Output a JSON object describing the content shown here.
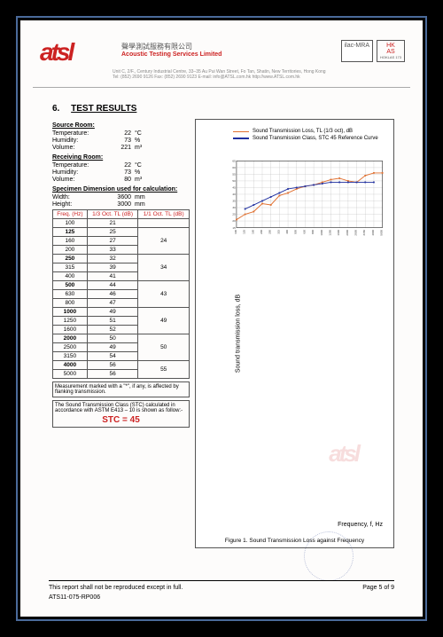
{
  "letterhead": {
    "logo_text": "atsl",
    "company_ch": "聲學測試服務有限公司",
    "company_en": "Acoustic Testing Services Limited",
    "address": "Unit C, 2/F., Century Industrial Centre, 33–35 Au Pui Wan Street, Fo Tan, Shatin, New Territories, Hong Kong   Tel: (852) 2690 9126   Fax: (852) 2690 9123   E-mail: info@ATSL.com.hk   http://www.ATSL.com.hk",
    "accred_left": "ilac-MRA",
    "accred_right_top": "HK",
    "accred_right_bottom": "AS",
    "accred_num": "HOKLAS 173"
  },
  "section": {
    "number": "6.",
    "title": "TEST RESULTS"
  },
  "source_room": {
    "heading": "Source Room:",
    "items": [
      {
        "label": "Temperature:",
        "value": "22",
        "unit": "°C"
      },
      {
        "label": "Humidity:",
        "value": "73",
        "unit": "%"
      },
      {
        "label": "Volume:",
        "value": "221",
        "unit": "m³"
      }
    ]
  },
  "receiving_room": {
    "heading": "Receiving Room:",
    "items": [
      {
        "label": "Temperature:",
        "value": "22",
        "unit": "°C"
      },
      {
        "label": "Humidity:",
        "value": "73",
        "unit": "%"
      },
      {
        "label": "Volume:",
        "value": "80",
        "unit": "m³"
      }
    ]
  },
  "specimen": {
    "heading": "Specimen Dimension used for calculation:",
    "items": [
      {
        "label": "Width:",
        "value": "3600",
        "unit": "mm"
      },
      {
        "label": "Height:",
        "value": "3000",
        "unit": "mm"
      }
    ]
  },
  "freq_table": {
    "headers": [
      "Freq. (Hz)",
      "1/3 Oct. TL (dB)",
      "1/1 Oct. TL (dB)"
    ],
    "rows": [
      {
        "f": "100",
        "t3": "21",
        "t1": "",
        "b": false
      },
      {
        "f": "125",
        "t3": "25",
        "t1": "24",
        "b": true
      },
      {
        "f": "160",
        "t3": "27",
        "t1": "",
        "b": false
      },
      {
        "f": "200",
        "t3": "33",
        "t1": "",
        "b": false
      },
      {
        "f": "250",
        "t3": "32",
        "t1": "34",
        "b": true
      },
      {
        "f": "315",
        "t3": "39",
        "t1": "",
        "b": false
      },
      {
        "f": "400",
        "t3": "41",
        "t1": "",
        "b": false
      },
      {
        "f": "500",
        "t3": "44",
        "t1": "43",
        "b": true
      },
      {
        "f": "630",
        "t3": "46",
        "t1": "",
        "b": false
      },
      {
        "f": "800",
        "t3": "47",
        "t1": "",
        "b": false
      },
      {
        "f": "1000",
        "t3": "49",
        "t1": "49",
        "b": true
      },
      {
        "f": "1250",
        "t3": "51",
        "t1": "",
        "b": false
      },
      {
        "f": "1600",
        "t3": "52",
        "t1": "",
        "b": false
      },
      {
        "f": "2000",
        "t3": "50",
        "t1": "50",
        "b": true
      },
      {
        "f": "2500",
        "t3": "49",
        "t1": "",
        "b": false
      },
      {
        "f": "3150",
        "t3": "54",
        "t1": "",
        "b": false
      },
      {
        "f": "4000",
        "t3": "56",
        "t1": "55",
        "b": true
      },
      {
        "f": "5000",
        "t3": "56",
        "t1": "",
        "b": false
      }
    ]
  },
  "note_marked": "Measurement marked with a \"*\", if any, is affected by flanking transmission.",
  "note_stc": "The Sound Transmission Class (STC) calculated in accordance with ASTM E413 – 10 is shown as follow:-",
  "stc_value": "STC  =  45",
  "chart": {
    "legend": [
      "Sound Transmission Loss, TL (1/3 oct), dB",
      "Sound Transmission Class, STC 45 Reference Curve"
    ],
    "ylabel": "Sound transmission loss, dB",
    "xlabel": "Frequency, f, Hz",
    "caption": "Figure 1. Sound Transmission Loss against Frequency"
  },
  "chart_data": {
    "type": "line",
    "xlabel": "Frequency, f, Hz",
    "ylabel": "Sound transmission loss, dB",
    "x_scale": "log_1/3_octave",
    "categories": [
      "100",
      "125",
      "160",
      "200",
      "250",
      "315",
      "400",
      "500",
      "630",
      "800",
      "1000",
      "1250",
      "1600",
      "2000",
      "2500",
      "3150",
      "4000",
      "5000"
    ],
    "ylim": [
      15,
      65
    ],
    "y_ticks": [
      15,
      20,
      25,
      30,
      35,
      40,
      45,
      50,
      55,
      60,
      65
    ],
    "series": [
      {
        "name": "Sound Transmission Loss, TL (1/3 oct), dB",
        "color": "#e07030",
        "values": [
          21,
          25,
          27,
          33,
          32,
          39,
          41,
          44,
          46,
          47,
          49,
          51,
          52,
          50,
          49,
          54,
          56,
          56
        ]
      },
      {
        "name": "Sound Transmission Class, STC 45 Reference Curve",
        "color": "#2030a0",
        "x": [
          "125",
          "160",
          "200",
          "250",
          "315",
          "400",
          "500",
          "630",
          "800",
          "1000",
          "1250",
          "1600",
          "2000",
          "2500",
          "3150",
          "4000"
        ],
        "values": [
          29,
          32,
          35,
          38,
          41,
          44,
          45,
          46,
          47,
          48,
          49,
          49,
          49,
          49,
          49,
          49
        ]
      }
    ],
    "grid": true
  },
  "footer": {
    "disclaimer": "This report shall not be reproduced except in full.",
    "ref": "ATS11-075-RP006",
    "page": "Page 5 of 9"
  }
}
